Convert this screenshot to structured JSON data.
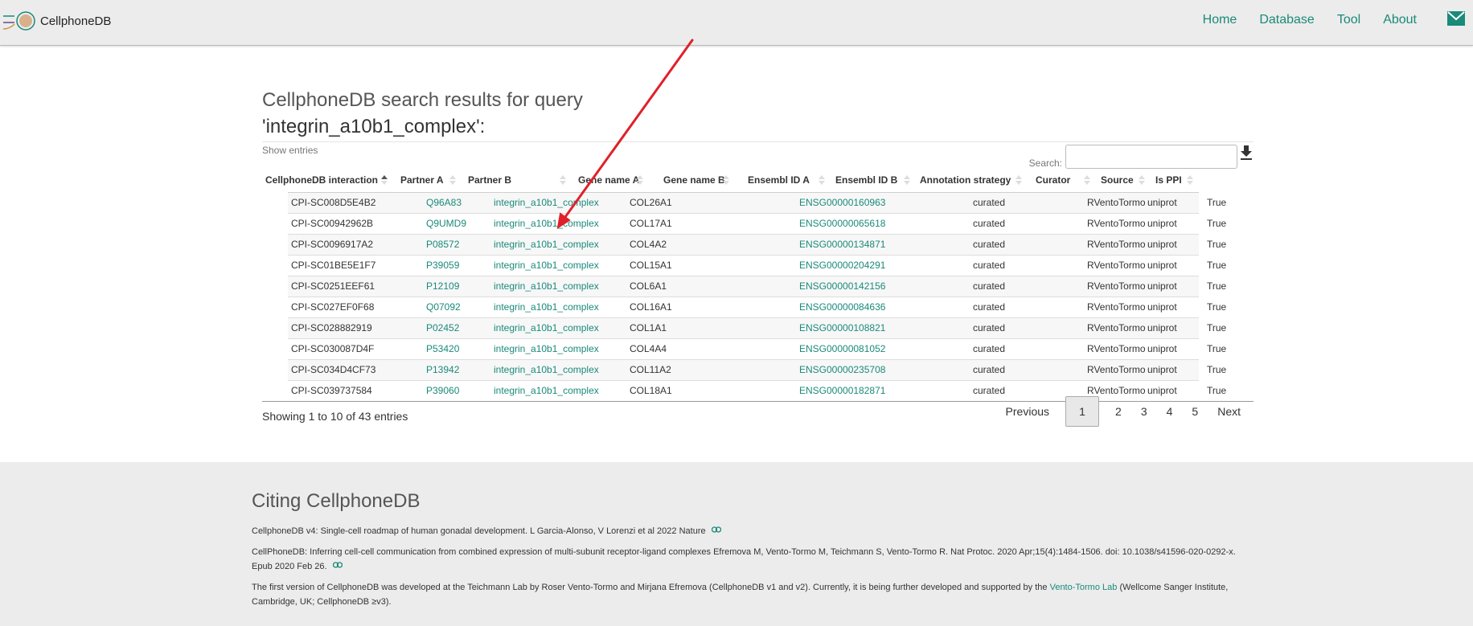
{
  "brand": {
    "name": "CellphoneDB"
  },
  "nav": {
    "items": [
      "Home",
      "Database",
      "Tool",
      "About"
    ]
  },
  "colors": {
    "accent": "#1a8a7a",
    "arrow": "#e0202a",
    "navbar": "#ececec"
  },
  "search_results": {
    "title_prefix": "CellphoneDB search results for query",
    "query": "'integrin_a10b1_complex':",
    "show_entries": "Show entries",
    "search_label": "Search:",
    "search_value": ""
  },
  "table": {
    "columns": [
      "CellphoneDB interaction",
      "Partner A",
      "Partner B",
      "Gene name A",
      "Gene name B",
      "Ensembl ID A",
      "Ensembl ID B",
      "Annotation strategy",
      "Curator",
      "Source",
      "Is PPI"
    ],
    "rows": [
      {
        "interaction": "CPI-SC008D5E4B2",
        "partner_a": "Q96A83",
        "partner_b": "integrin_a10b1_complex",
        "gene_a": "COL26A1",
        "gene_b": "",
        "ensembl_a": "ENSG00000160963",
        "ensembl_b": "",
        "strategy": "curated",
        "curator": "RVentoTormo",
        "source": "uniprot",
        "is_ppi": "True"
      },
      {
        "interaction": "CPI-SC00942962B",
        "partner_a": "Q9UMD9",
        "partner_b": "integrin_a10b1_complex",
        "gene_a": "COL17A1",
        "gene_b": "",
        "ensembl_a": "ENSG00000065618",
        "ensembl_b": "",
        "strategy": "curated",
        "curator": "RVentoTormo",
        "source": "uniprot",
        "is_ppi": "True"
      },
      {
        "interaction": "CPI-SC0096917A2",
        "partner_a": "P08572",
        "partner_b": "integrin_a10b1_complex",
        "gene_a": "COL4A2",
        "gene_b": "",
        "ensembl_a": "ENSG00000134871",
        "ensembl_b": "",
        "strategy": "curated",
        "curator": "RVentoTormo",
        "source": "uniprot",
        "is_ppi": "True"
      },
      {
        "interaction": "CPI-SC01BE5E1F7",
        "partner_a": "P39059",
        "partner_b": "integrin_a10b1_complex",
        "gene_a": "COL15A1",
        "gene_b": "",
        "ensembl_a": "ENSG00000204291",
        "ensembl_b": "",
        "strategy": "curated",
        "curator": "RVentoTormo",
        "source": "uniprot",
        "is_ppi": "True"
      },
      {
        "interaction": "CPI-SC0251EEF61",
        "partner_a": "P12109",
        "partner_b": "integrin_a10b1_complex",
        "gene_a": "COL6A1",
        "gene_b": "",
        "ensembl_a": "ENSG00000142156",
        "ensembl_b": "",
        "strategy": "curated",
        "curator": "RVentoTormo",
        "source": "uniprot",
        "is_ppi": "True"
      },
      {
        "interaction": "CPI-SC027EF0F68",
        "partner_a": "Q07092",
        "partner_b": "integrin_a10b1_complex",
        "gene_a": "COL16A1",
        "gene_b": "",
        "ensembl_a": "ENSG00000084636",
        "ensembl_b": "",
        "strategy": "curated",
        "curator": "RVentoTormo",
        "source": "uniprot",
        "is_ppi": "True"
      },
      {
        "interaction": "CPI-SC028882919",
        "partner_a": "P02452",
        "partner_b": "integrin_a10b1_complex",
        "gene_a": "COL1A1",
        "gene_b": "",
        "ensembl_a": "ENSG00000108821",
        "ensembl_b": "",
        "strategy": "curated",
        "curator": "RVentoTormo",
        "source": "uniprot",
        "is_ppi": "True"
      },
      {
        "interaction": "CPI-SC030087D4F",
        "partner_a": "P53420",
        "partner_b": "integrin_a10b1_complex",
        "gene_a": "COL4A4",
        "gene_b": "",
        "ensembl_a": "ENSG00000081052",
        "ensembl_b": "",
        "strategy": "curated",
        "curator": "RVentoTormo",
        "source": "uniprot",
        "is_ppi": "True"
      },
      {
        "interaction": "CPI-SC034D4CF73",
        "partner_a": "P13942",
        "partner_b": "integrin_a10b1_complex",
        "gene_a": "COL11A2",
        "gene_b": "",
        "ensembl_a": "ENSG00000235708",
        "ensembl_b": "",
        "strategy": "curated",
        "curator": "RVentoTormo",
        "source": "uniprot",
        "is_ppi": "True"
      },
      {
        "interaction": "CPI-SC039737584",
        "partner_a": "P39060",
        "partner_b": "integrin_a10b1_complex",
        "gene_a": "COL18A1",
        "gene_b": "",
        "ensembl_a": "ENSG00000182871",
        "ensembl_b": "",
        "strategy": "curated",
        "curator": "RVentoTormo",
        "source": "uniprot",
        "is_ppi": "True"
      }
    ],
    "info": "Showing 1 to 10 of 43 entries",
    "pagination": {
      "previous": "Previous",
      "pages": [
        "1",
        "2",
        "3",
        "4",
        "5"
      ],
      "current": "1",
      "next": "Next"
    }
  },
  "citing": {
    "title": "Citing CellphoneDB",
    "citation_1": "CellphoneDB v4: Single-cell roadmap of human gonadal development. L Garcia-Alonso, V Lorenzi et al 2022 Nature",
    "citation_2": "CellPhoneDB: Inferring cell-cell communication from combined expression of multi-subunit receptor-ligand complexes Efremova M, Vento-Tormo M, Teichmann S, Vento-Tormo R. Nat Protoc. 2020 Apr;15(4):1484-1506. doi: 10.1038/s41596-020-0292-x. Epub 2020 Feb 26.",
    "history_before": "The first version of CellphoneDB was developed at the Teichmann Lab by Roser Vento-Tormo and Mirjana Efremova (CellphoneDB v1 and v2). Currently, it is being further developed and supported by the",
    "history_link": "Vento-Tormo Lab",
    "history_after": "(Wellcome Sanger Institute, Cambridge, UK; CellphoneDB ≥v3)."
  },
  "icons": [
    "cellphonedb-logo-icon",
    "mail-icon",
    "download-icon",
    "sort-asc-icon",
    "sort-icon",
    "external-link-icon"
  ]
}
